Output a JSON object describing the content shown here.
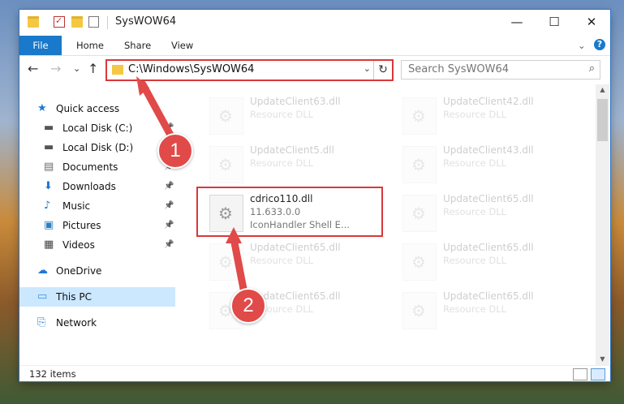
{
  "window": {
    "title": "SysWOW64",
    "controls": {
      "minimize": "—",
      "maximize": "☐",
      "close": "✕"
    }
  },
  "ribbon": {
    "tabs": [
      "File",
      "Home",
      "Share",
      "View"
    ],
    "collapse_glyph": "⌄",
    "help_glyph": "?"
  },
  "nav": {
    "back_glyph": "←",
    "forward_glyph": "→",
    "recent_glyph": "⌄",
    "up_glyph": "↑",
    "address": "C:\\Windows\\SysWOW64",
    "address_dropdown": "⌄",
    "refresh_glyph": "↻",
    "search_placeholder": "Search SysWOW64",
    "search_glyph": "⌕"
  },
  "sidebar": {
    "items": [
      {
        "label": "Quick access",
        "icon": "star-icon",
        "glyph": "★",
        "color": "#1e78d2",
        "pinned": false
      },
      {
        "label": "Local Disk (C:)",
        "icon": "drive-icon",
        "glyph": "▬",
        "color": "#555555",
        "pinned": true
      },
      {
        "label": "Local Disk (D:)",
        "icon": "drive-icon",
        "glyph": "▬",
        "color": "#555555",
        "pinned": true
      },
      {
        "label": "Documents",
        "icon": "documents-icon",
        "glyph": "▤",
        "color": "#6a6a6a",
        "pinned": true
      },
      {
        "label": "Downloads",
        "icon": "download-icon",
        "glyph": "⬇",
        "color": "#1e78d2",
        "pinned": true
      },
      {
        "label": "Music",
        "icon": "music-icon",
        "glyph": "♪",
        "color": "#1e78d2",
        "pinned": true
      },
      {
        "label": "Pictures",
        "icon": "pictures-icon",
        "glyph": "▣",
        "color": "#2f7fbf",
        "pinned": true
      },
      {
        "label": "Videos",
        "icon": "video-icon",
        "glyph": "▦",
        "color": "#444444",
        "pinned": true
      },
      {
        "label": "OneDrive",
        "icon": "cloud-icon",
        "glyph": "☁",
        "color": "#1e78d2",
        "pinned": false
      },
      {
        "label": "This PC",
        "icon": "computer-icon",
        "glyph": "▭",
        "color": "#3a8fd9",
        "pinned": false
      },
      {
        "label": "Network",
        "icon": "network-icon",
        "glyph": "⎘",
        "color": "#1e78d2",
        "pinned": false
      }
    ],
    "pin_glyph": "📌"
  },
  "files": {
    "items": [
      {
        "name": "UpdateClient63.dll",
        "line2": "Resource DLL",
        "line3": "",
        "faded": true
      },
      {
        "name": "UpdateClient42.dll",
        "line2": "Resource DLL",
        "line3": "",
        "faded": true
      },
      {
        "name": "UpdateClient5.dll",
        "line2": "Resource DLL",
        "line3": "",
        "faded": true
      },
      {
        "name": "UpdateClient43.dll",
        "line2": "Resource DLL",
        "line3": "",
        "faded": true
      },
      {
        "name": "cdrico110.dll",
        "line2": "11.633.0.0",
        "line3": "IconHandler Shell E...",
        "faded": false
      },
      {
        "name": "UpdateClient65.dll",
        "line2": "Resource DLL",
        "line3": "",
        "faded": true
      },
      {
        "name": "UpdateClient65.dll",
        "line2": "Resource DLL",
        "line3": "",
        "faded": true
      },
      {
        "name": "UpdateClient65.dll",
        "line2": "Resource DLL",
        "line3": "",
        "faded": true
      },
      {
        "name": "UpdateClient65.dll",
        "line2": "Resource DLL",
        "line3": "",
        "faded": true
      },
      {
        "name": "UpdateClient65.dll",
        "line2": "Resource DLL",
        "line3": "",
        "faded": true
      }
    ]
  },
  "status": {
    "item_count": "132 items"
  },
  "annotations": {
    "callout1": "1",
    "callout2": "2",
    "color": "#e04a49"
  }
}
